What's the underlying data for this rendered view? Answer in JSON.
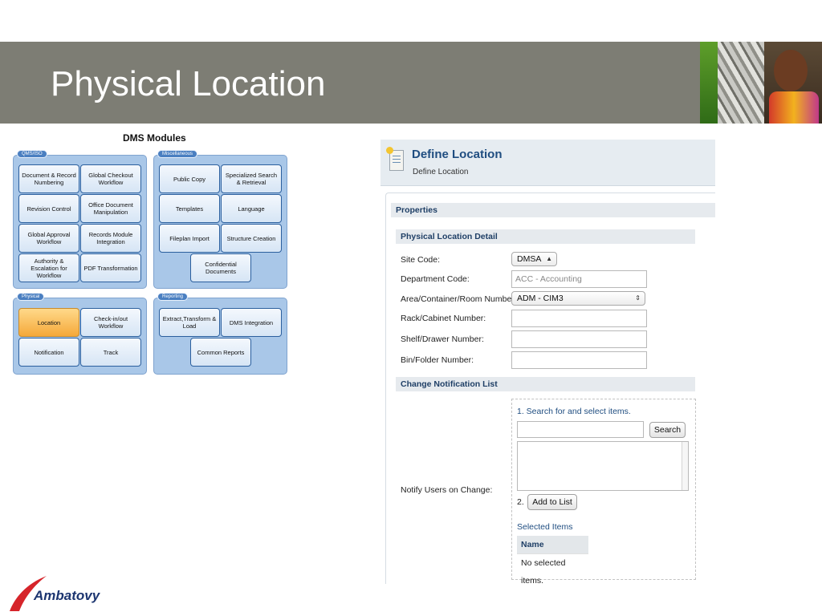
{
  "slide": {
    "title": "Physical Location",
    "brand": "Ambatovy",
    "colors": {
      "header_bg": "#7d7d74",
      "brand_red": "#d6242a",
      "brand_blue": "#1c3570",
      "module_active": "#f5a93a",
      "module_panel": "#a9c7e8"
    }
  },
  "dms": {
    "title": "DMS Modules",
    "groups": [
      {
        "name": "QMS/ISO",
        "modules": [
          "Document & Record Numbering",
          "Global Checkout Workflow",
          "Revision Control",
          "Office Document Manipulation",
          "Global Approval Workflow",
          "Records Module Integration",
          "Authority & Escalation for Workflow",
          "PDF Transformation"
        ]
      },
      {
        "name": "Miscellaneous",
        "modules": [
          "Public Copy",
          "Specialized Search & Retrieval",
          "Templates",
          "Language",
          "Fileplan Import",
          "Structure Creation",
          "Confidential Documents"
        ]
      },
      {
        "name": "Physical",
        "modules": [
          "Location",
          "Check-in/out Workflow",
          "Notification",
          "Track"
        ],
        "active": "Location"
      },
      {
        "name": "Reporting",
        "modules": [
          "Extract,Transform & Load",
          "DMS Integration",
          "Common Reports"
        ]
      }
    ]
  },
  "form": {
    "icon": "document-icon",
    "title": "Define Location",
    "subtitle": "Define Location",
    "properties_header": "Properties",
    "detail_header": "Physical Location Detail",
    "fields": {
      "site_code": {
        "label": "Site Code:",
        "value": "DMSA"
      },
      "department_code": {
        "label": "Department Code:",
        "value": "ACC - Accounting"
      },
      "area": {
        "label": "Area/Container/Room Number:",
        "value": "ADM - CIM3"
      },
      "rack": {
        "label": "Rack/Cabinet Number:",
        "value": ""
      },
      "shelf": {
        "label": "Shelf/Drawer Number:",
        "value": ""
      },
      "bin": {
        "label": "Bin/Folder Number:",
        "value": ""
      }
    },
    "notification": {
      "header": "Change Notification List",
      "label": "Notify Users on Change:",
      "step1": "1. Search for and select items.",
      "search_value": "",
      "search_button": "Search",
      "step2": "2.",
      "add_button": "Add to List",
      "selected_items_label": "Selected Items",
      "table_header": "Name",
      "empty_text": "No selected items."
    }
  }
}
